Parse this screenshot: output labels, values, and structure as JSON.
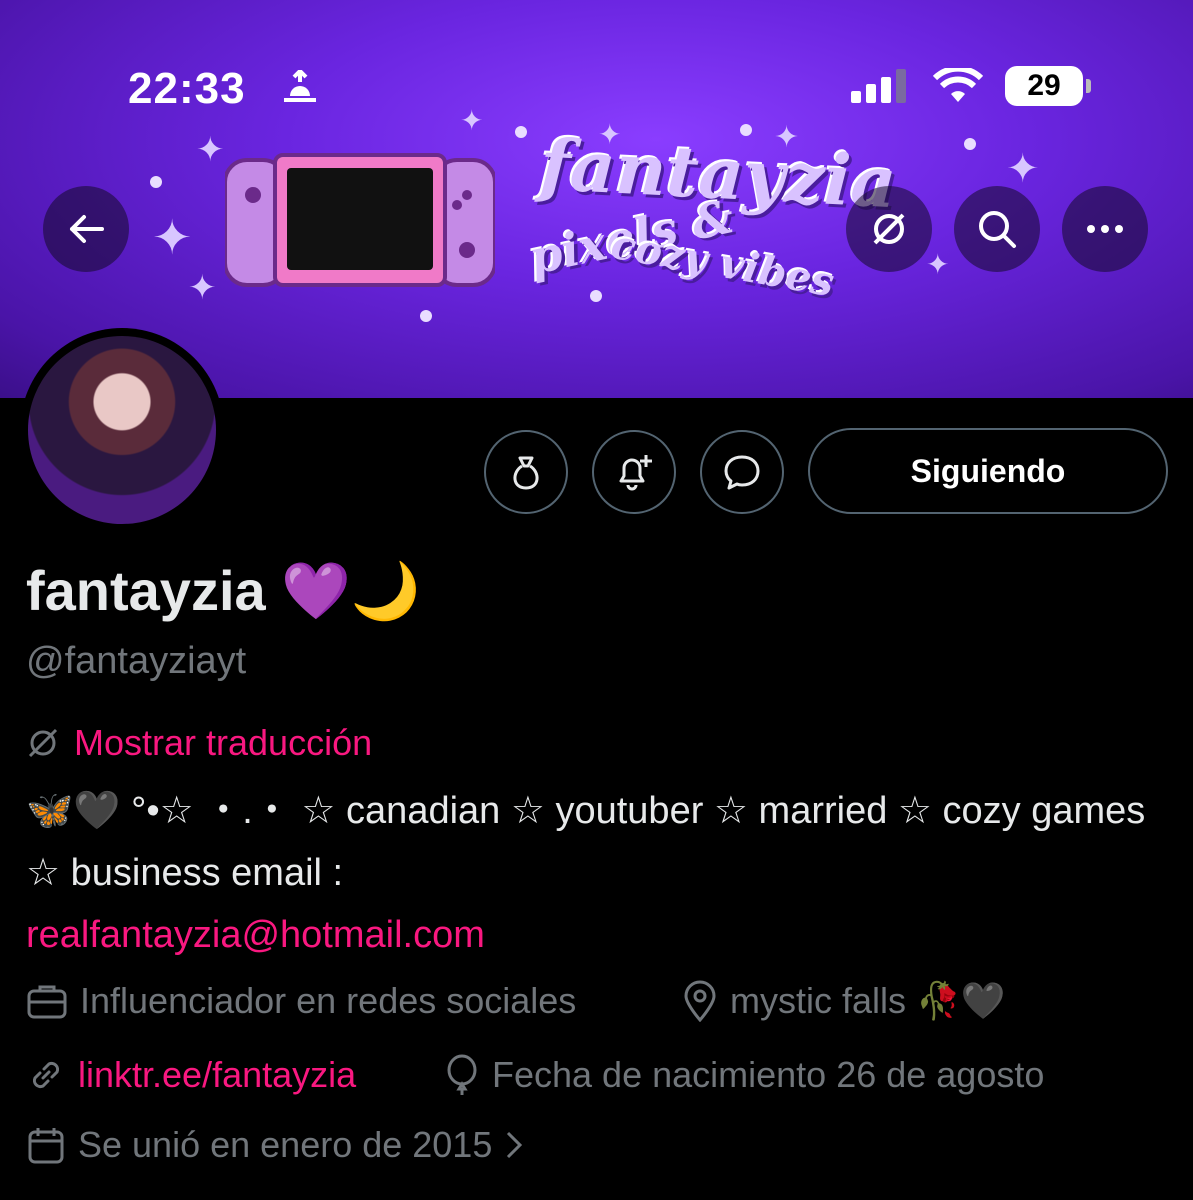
{
  "status_bar": {
    "time": "22:33",
    "battery": "29"
  },
  "banner": {
    "title": "fantayzia",
    "subtitle_1": "pixels &",
    "subtitle_2": "cozy vibes"
  },
  "profile": {
    "display_name": "fantayzia 💜🌙",
    "handle": "@fantayziayt",
    "follow_label": "Siguiendo",
    "translate_label": "Mostrar traducción",
    "bio_text": "🦋🖤 °•☆ ・.・ ☆ canadian ☆ youtuber ☆ married ☆ cozy games ☆ business email :",
    "bio_email": "realfantayzia@hotmail.com",
    "category": "Influenciador en redes sociales",
    "location": "mystic falls 🥀🖤",
    "link": "linktr.ee/fantayzia",
    "birthday": "Fecha de nacimiento 26 de agosto",
    "joined": "Se unió en enero de 2015"
  },
  "colors": {
    "accent": "#f91880",
    "muted": "#71767b",
    "banner": "#6a25e0"
  }
}
